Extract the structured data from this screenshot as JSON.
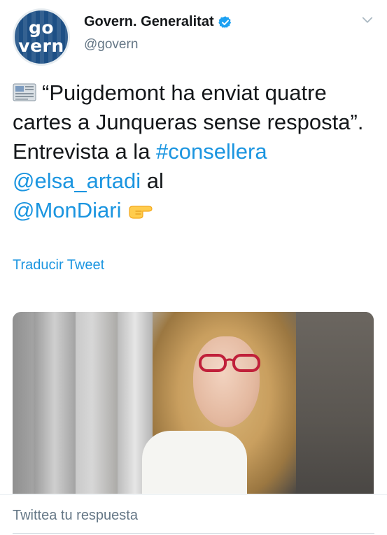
{
  "tweet": {
    "author": {
      "display_name": "Govern. Generalitat",
      "handle": "@govern",
      "avatar_logo_line1": "go",
      "avatar_logo_line2": "vern",
      "verified": true
    },
    "text": {
      "part1": "“Puigdemont ha enviat quatre cartes a Junqueras sense resposta”. Entrevista a la ",
      "hashtag": "#consellera",
      "space": " ",
      "mention1": "@elsa_artadi",
      "part2": " al",
      "mention2": "@MonDiari"
    },
    "translate_label": "Traducir Tweet",
    "icons": {
      "leading": "newspaper-icon",
      "trailing": "pointing-right-icon",
      "verified": "verified-badge-icon",
      "menu": "chevron-down-icon"
    }
  },
  "reply": {
    "placeholder": "Twittea tu respuesta"
  },
  "colors": {
    "link": "#1b95e0",
    "text": "#14171a",
    "secondary": "#657786",
    "avatar": "#1d4f85"
  }
}
